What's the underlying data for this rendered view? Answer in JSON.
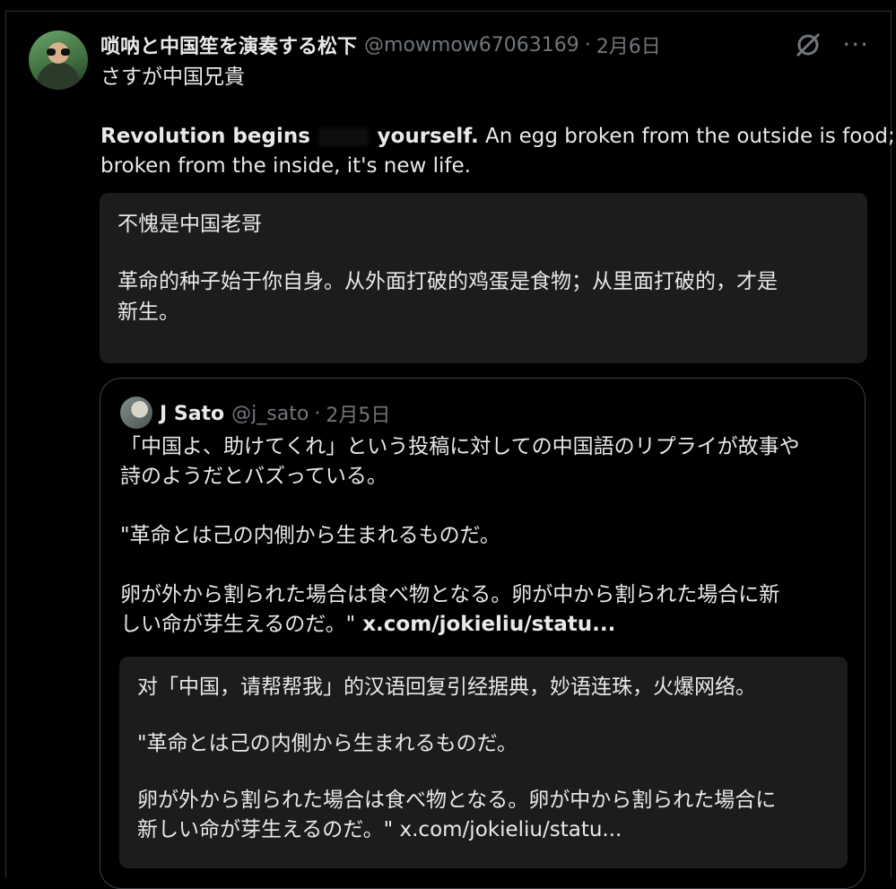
{
  "post": {
    "author_name": "唢呐と中国笙を演奏する松下",
    "handle": "@mowmow67063169",
    "separator": "·",
    "date": "2月6日",
    "icons": {
      "grok": "grok-slash-icon",
      "more": "more-options-icon"
    },
    "text_line1": "さすが中国兄貴",
    "english_bold_a": "Revolution begins",
    "english_bold_b": "yourself.",
    "english_rest": " An egg broken from the outside is food;",
    "english_line2": "broken from the inside, it's new life.",
    "translation": {
      "line1": "不愧是中国老哥",
      "line2": "革命的种子始于你自身。从外面打破的鸡蛋是食物；从里面打破的，才是",
      "line3": "新生。"
    }
  },
  "quoted": {
    "author_name": "J Sato",
    "handle": "@j_sato",
    "separator": "·",
    "date": "2月5日",
    "lines": [
      "「中国よ、助けてくれ」という投稿に対しての中国語のリプライが故事や",
      "詩のようだとバズっている。",
      "\"革命とは己の内側から生まれるものだ。",
      "卵が外から割られた場合は食べ物となる。卵が中から割られた場合に新",
      "しい命が芽生えるのだ。\"",
      " x.com/jokieliu/statu..."
    ],
    "translation": {
      "line1": "对「中国，请帮帮我」的汉语回复引经据典，妙语连珠，火爆网络。",
      "line2": "\"革命とは己の内側から生まれるものだ。",
      "line3": "卵が外から割られた場合は食べ物となる。卵が中から割られた場合に",
      "line4": "新しい命が芽生えるのだ。\"",
      "line4_link": " x.com/jokieliu/statu..."
    }
  }
}
